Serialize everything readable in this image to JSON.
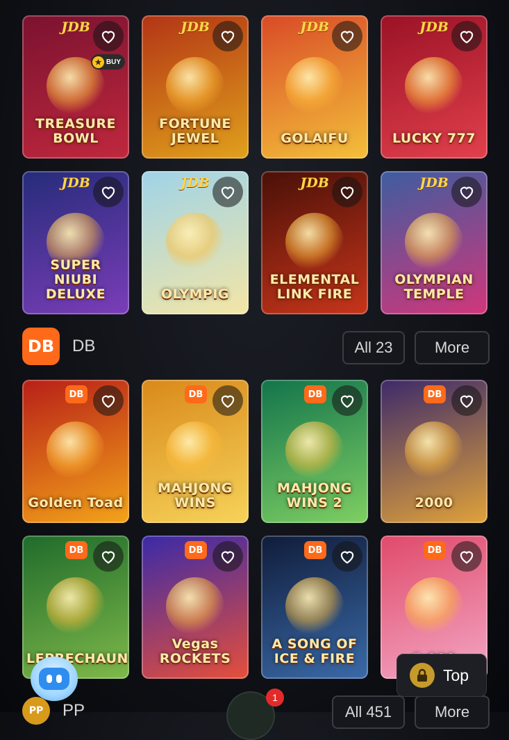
{
  "rows": [
    [
      {
        "title": "TREASURE BOWL",
        "brand": "JDB",
        "badge": "BUY",
        "bg": [
          "#7a1230",
          "#c0283d"
        ]
      },
      {
        "title": "FORTUNE JEWEL",
        "brand": "JDB",
        "bg": [
          "#b33415",
          "#e0a11c"
        ]
      },
      {
        "title": "GOLAIFU",
        "brand": "JDB",
        "bg": [
          "#d94a27",
          "#f3c03a"
        ]
      },
      {
        "title": "LUCKY 777",
        "brand": "JDB",
        "bg": [
          "#9a1226",
          "#e2404c"
        ]
      }
    ],
    [
      {
        "title": "SUPER NIUBI DELUXE",
        "brand": "JDB",
        "bg": [
          "#252c7a",
          "#7b3db8"
        ]
      },
      {
        "title": "OLYMPIG",
        "brand": "JDB",
        "bg": [
          "#9fd3e8",
          "#f4e6a6"
        ]
      },
      {
        "title": "ELEMENTAL LINK FIRE",
        "brand": "JDB",
        "bg": [
          "#4a1008",
          "#c7351a"
        ]
      },
      {
        "title": "OLYMPIAN TEMPLE",
        "brand": "JDB",
        "bg": [
          "#3d5da0",
          "#d2367a"
        ]
      }
    ],
    [
      {
        "title": "Golden Toad",
        "brand": "DB",
        "bg": [
          "#b81f18",
          "#f3a419"
        ]
      },
      {
        "title": "MAHJONG WINS",
        "brand": "DB",
        "bg": [
          "#d9891a",
          "#f6d35a"
        ]
      },
      {
        "title": "MAHJONG WINS 2",
        "brand": "DB",
        "bg": [
          "#12744b",
          "#7fcf63"
        ]
      },
      {
        "title": "2000",
        "brand": "DB",
        "bg": [
          "#3d2a6a",
          "#e0a23a"
        ]
      }
    ],
    [
      {
        "title": "LEPRECHAUN",
        "brand": "DB",
        "bg": [
          "#1f6b2b",
          "#7fb94a"
        ]
      },
      {
        "title": "Vegas ROCKETS",
        "brand": "DB",
        "bg": [
          "#3a2aa8",
          "#e64f3a"
        ]
      },
      {
        "title": "A SONG OF ICE & FIRE",
        "brand": "DB",
        "bg": [
          "#101c3a",
          "#3a6aa8"
        ]
      },
      {
        "title": "5,000",
        "brand": "DB",
        "bg": [
          "#e04a6a",
          "#f3a7c5"
        ]
      }
    ]
  ],
  "sections": [
    {
      "logo": "DB",
      "name": "DB",
      "all_label": "All 23",
      "more_label": "More"
    },
    {
      "logo": "PP",
      "name": "PP",
      "all_label": "All 451",
      "more_label": "More"
    }
  ],
  "top_button": {
    "label": "Top"
  },
  "fab_badge": "1",
  "icons": {
    "favorite": "heart-outline-icon",
    "top": "lock-icon",
    "assistant": "robot-icon"
  },
  "colors": {
    "accent": "#ff6a1a",
    "background": "#0d0f14"
  }
}
